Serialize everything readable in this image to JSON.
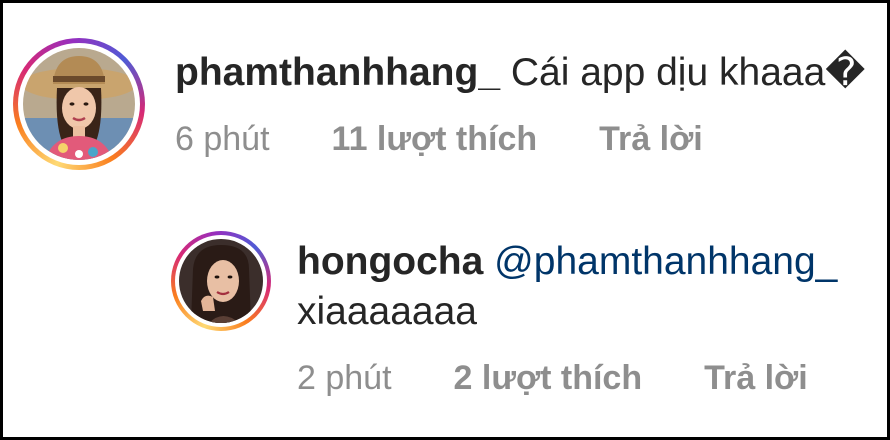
{
  "comments": [
    {
      "username": "phamthanhhang_",
      "text": "Cái app dịu khaaa�",
      "time": "6 phút",
      "likes": "11 lượt thích",
      "reply_label": "Trả lời",
      "avatar_icon": "profile-photo-woman-hat"
    }
  ],
  "reply": {
    "username": "hongocha",
    "mention": "@phamthanhhang_",
    "text": "xiaaaaaaa",
    "time": "2 phút",
    "likes": "2 lượt thích",
    "reply_label": "Trả lời",
    "avatar_icon": "profile-photo-woman"
  },
  "colors": {
    "username": "#262626",
    "mention": "#003569",
    "meta": "#8e8e8e",
    "story_ring": [
      "#feda75",
      "#fa7e1e",
      "#d62976",
      "#962fbf",
      "#4f5bd5"
    ]
  }
}
